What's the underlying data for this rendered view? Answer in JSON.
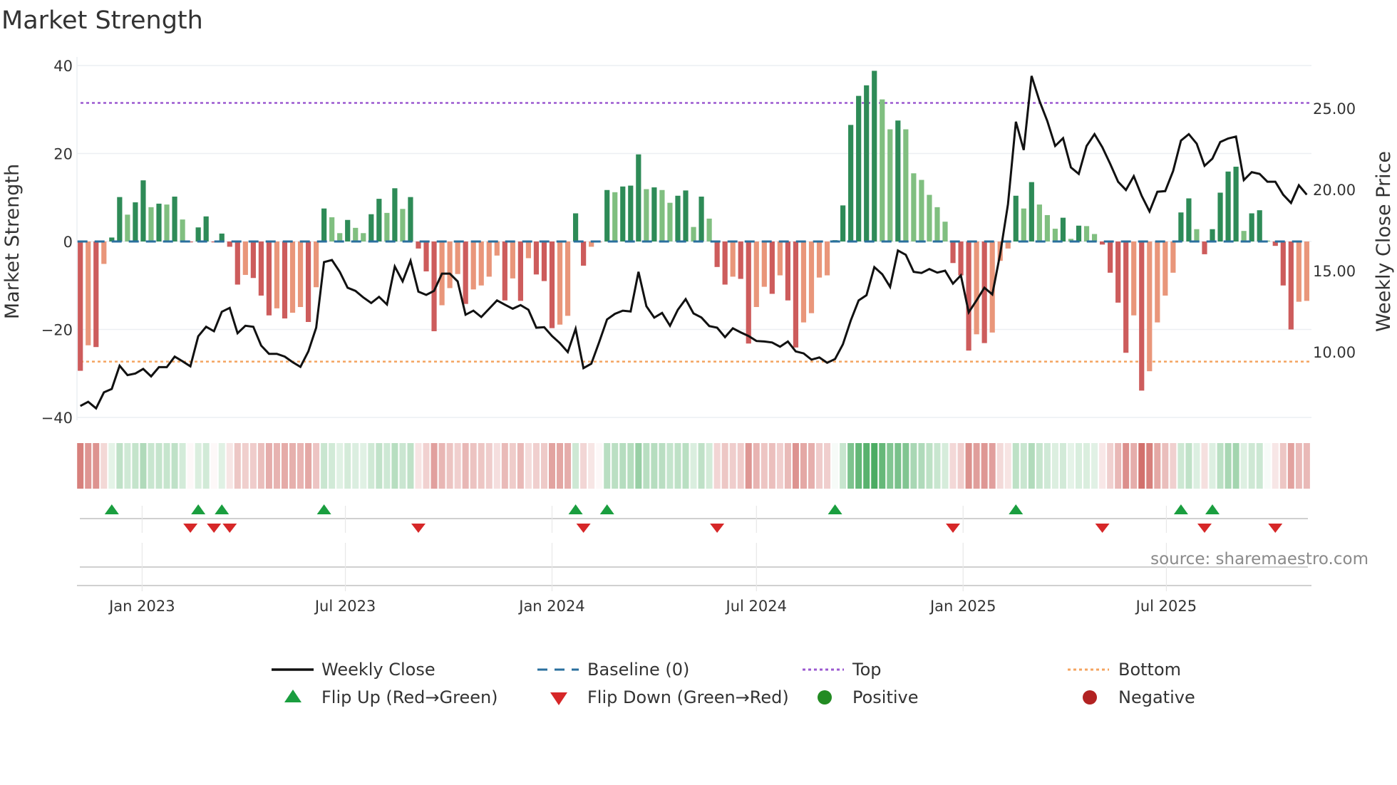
{
  "chart_data": {
    "type": "bar",
    "title": "Market Strength",
    "ylabel": "Market Strength",
    "y2label": "Weekly Close Price",
    "source": "source: sharemaestro.com",
    "x_start": "2022-11-07",
    "x_step_days": 7,
    "ylim": [
      -40,
      40
    ],
    "yticks": [
      40,
      20,
      0,
      -20,
      -40
    ],
    "ytick_labels": [
      "40",
      "20",
      "0",
      "−20",
      "−40"
    ],
    "y2lim": [
      5.96,
      27.6
    ],
    "y2ticks": [
      25,
      20,
      15,
      10
    ],
    "y2tick_labels": [
      "25.00",
      "20.00",
      "15.00",
      "10.00"
    ],
    "xticks": [
      {
        "date": "2023-01-01",
        "label": "Jan 2023"
      },
      {
        "date": "2023-07-01",
        "label": "Jul 2023"
      },
      {
        "date": "2024-01-01",
        "label": "Jan 2024"
      },
      {
        "date": "2024-07-01",
        "label": "Jul 2024"
      },
      {
        "date": "2025-01-01",
        "label": "Jan 2025"
      },
      {
        "date": "2025-07-01",
        "label": "Jul 2025"
      }
    ],
    "top_threshold": 31.5,
    "bottom_threshold": -27.3,
    "baseline": 0,
    "strength": [
      -29.4,
      -23.6,
      -24,
      -5.1,
      0.9,
      10.1,
      6.1,
      8.9,
      13.9,
      7.8,
      8.6,
      8.4,
      10.2,
      5.0,
      -0.2,
      3.2,
      5.7,
      -0.2,
      1.8,
      -1.2,
      -9.8,
      -7.6,
      -8.3,
      -12.3,
      -16.8,
      -15.2,
      -17.5,
      -16.2,
      -14.9,
      -18.3,
      -10.4,
      7.5,
      5.5,
      1.9,
      4.9,
      3.1,
      1.9,
      6.2,
      9.7,
      6.5,
      12.1,
      7.4,
      10.1,
      -1.6,
      -6.8,
      -20.4,
      -14.5,
      -10.6,
      -7.4,
      -14.2,
      -10.9,
      -10.0,
      -8.0,
      -3.2,
      -13.4,
      -8.4,
      -13.5,
      -3.8,
      -7.5,
      -9.0,
      -19.7,
      -18.9,
      -16.9,
      6.4,
      -5.5,
      -1.2,
      -0.2,
      11.7,
      11.2,
      12.5,
      12.7,
      19.8,
      11.9,
      12.3,
      11.7,
      8.8,
      10.4,
      11.6,
      3.3,
      10.2,
      5.2,
      -5.8,
      -9.8,
      -8.0,
      -8.5,
      -23.2,
      -14.9,
      -10.3,
      -11.9,
      -7.7,
      -13.4,
      -24.1,
      -18.4,
      -16.3,
      -8.2,
      -7.7,
      0.3,
      8.2,
      26.5,
      33.1,
      35.5,
      38.8,
      32.3,
      25.5,
      27.5,
      25.5,
      15.5,
      14.0,
      10.6,
      7.8,
      4.5,
      -4.9,
      -7.7,
      -24.8,
      -21.1,
      -23.1,
      -20.7,
      -4.4,
      -1.6,
      10.4,
      7.5,
      13.5,
      8.4,
      6.0,
      2.9,
      5.4,
      0.6,
      3.6,
      3.5,
      1.7,
      -0.7,
      -7.1,
      -13.9,
      -25.3,
      -16.8,
      -33.9,
      -29.5,
      -18.4,
      -12.3,
      -7.1,
      6.6,
      9.8,
      2.8,
      -2.9,
      2.8,
      11.1,
      15.9,
      17.0,
      2.4,
      6.4,
      7.1,
      0.2,
      -1.0,
      -10.0,
      -20.0,
      -13.7,
      -13.5
    ],
    "weekly_close": [
      6.67,
      6.93,
      6.52,
      7.51,
      7.72,
      9.15,
      8.57,
      8.67,
      8.95,
      8.49,
      9.06,
      9.06,
      9.71,
      9.42,
      9.11,
      10.96,
      11.55,
      11.27,
      12.47,
      12.71,
      11.15,
      11.61,
      11.55,
      10.39,
      9.88,
      9.88,
      9.71,
      9.37,
      9.08,
      10.03,
      11.49,
      15.53,
      15.66,
      14.93,
      13.95,
      13.76,
      13.35,
      13.01,
      13.39,
      12.92,
      15.26,
      14.34,
      15.61,
      13.71,
      13.51,
      13.76,
      14.82,
      14.82,
      14.34,
      12.29,
      12.54,
      12.15,
      12.66,
      13.17,
      12.91,
      12.66,
      12.88,
      12.59,
      11.49,
      11.52,
      10.98,
      10.54,
      9.99,
      11.42,
      9.0,
      9.27,
      10.61,
      12.0,
      12.34,
      12.54,
      12.49,
      14.93,
      12.81,
      12.11,
      12.4,
      11.61,
      12.59,
      13.25,
      12.37,
      12.12,
      11.59,
      11.49,
      10.91,
      11.45,
      11.2,
      10.98,
      10.67,
      10.64,
      10.58,
      10.32,
      10.64,
      10.03,
      9.91,
      9.52,
      9.66,
      9.33,
      9.56,
      10.47,
      11.93,
      13.17,
      13.49,
      15.22,
      14.78,
      14.0,
      16.24,
      15.98,
      14.93,
      14.86,
      15.1,
      14.88,
      15.0,
      14.2,
      14.71,
      12.44,
      13.17,
      13.95,
      13.54,
      16.02,
      19.09,
      24.17,
      22.43,
      26.99,
      25.45,
      24.21,
      22.68,
      23.16,
      21.36,
      20.96,
      22.68,
      23.41,
      22.6,
      21.58,
      20.48,
      19.97,
      20.82,
      19.61,
      18.65,
      19.86,
      19.9,
      21.14,
      23.01,
      23.41,
      22.82,
      21.46,
      21.9,
      22.92,
      23.14,
      23.26,
      20.58,
      21.07,
      20.96,
      20.48,
      20.48,
      19.68,
      19.17,
      20.26,
      19.68
    ],
    "legend": {
      "placement": "bottom",
      "weekly_close": "Weekly Close",
      "baseline": "Baseline (0)",
      "top": "Top",
      "bottom": "Bottom",
      "flip_up": "Flip Up (Red→Green)",
      "flip_down": "Flip Down (Green→Red)",
      "positive": "Positive",
      "negative": "Negative"
    },
    "colors": {
      "pos_strong": "#2e8b57",
      "pos_weak": "#80bf80",
      "neg_strong": "#cd5c5c",
      "neg_weak": "#e9967a",
      "line": "#111111",
      "baseline": "#2a6f9e",
      "top": "#9b59d0",
      "bottom": "#f4a460",
      "flip_up": "#1a9e3f",
      "flip_down": "#d62728",
      "positive": "#228b22",
      "negative": "#b22222"
    }
  }
}
